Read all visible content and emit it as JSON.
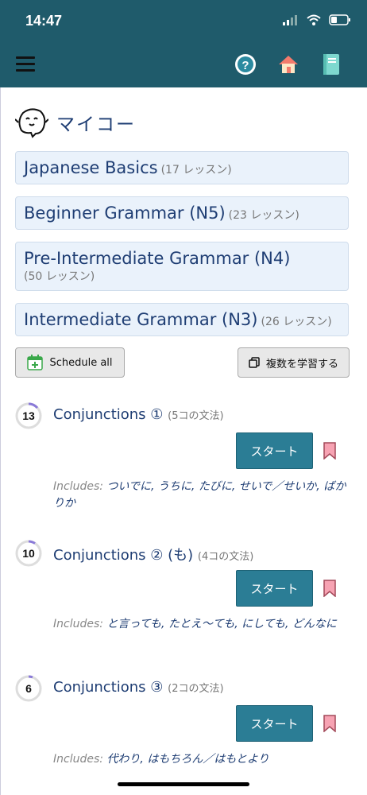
{
  "status_bar": {
    "time": "14:47"
  },
  "header": {
    "menu_icon": "hamburger-menu-icon",
    "help_icon": "question-circle-icon",
    "home_icon": "home-icon",
    "book_icon": "book-icon"
  },
  "app": {
    "name": "マイコー"
  },
  "courses": [
    {
      "title": "Japanese Basics",
      "count": "(17 レッスン)"
    },
    {
      "title": "Beginner Grammar (N5)",
      "count": "(23 レッスン)"
    },
    {
      "title": "Pre-Intermediate Grammar (N4)",
      "count": "(50 レッスン)"
    },
    {
      "title": "Intermediate Grammar (N3)",
      "count": "(26 レッスン)"
    }
  ],
  "actions": {
    "schedule_all": "Schedule all",
    "study_multiple": "複数を学習する"
  },
  "lessons": [
    {
      "progress": "13",
      "title": "Conjunctions ①",
      "count": "(5コの文法)",
      "start": "スタート",
      "includes_label": "Includes:",
      "includes": "ついでに, うちに, たびに, せいで／せいか, ばかりか"
    },
    {
      "progress": "10",
      "title": "Conjunctions ② (も)",
      "count": "(4コの文法)",
      "start": "スタート",
      "includes_label": "Includes:",
      "includes": "と言っても, たとえ〜ても, にしても, どんなに"
    },
    {
      "progress": "6",
      "title": "Conjunctions ③",
      "count": "(2コの文法)",
      "start": "スタート",
      "includes_label": "Includes:",
      "includes": "代わり, はもちろん／はもとより"
    }
  ],
  "colors": {
    "nav_bg": "#1f5b6b",
    "start_btn": "#2b7d95",
    "card_bg": "#eaf2fb",
    "title_text": "#1e3d73",
    "bookmark": "#f7a3b3"
  }
}
